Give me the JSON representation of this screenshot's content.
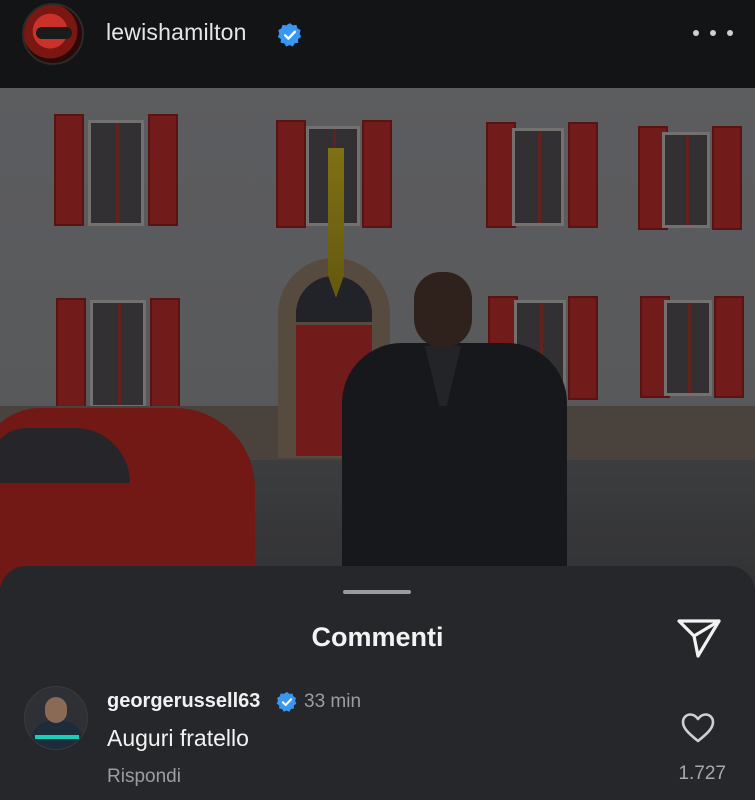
{
  "header": {
    "username": "lewishamilton",
    "verified_icon": "verified-badge-icon",
    "more_icon": "more-options-icon"
  },
  "post": {
    "image_description_icon": "post-photo"
  },
  "comments_sheet": {
    "title": "Commenti",
    "send_icon": "send-icon",
    "comments": [
      {
        "username": "georgerussell63",
        "verified": true,
        "time": "33 min",
        "text": "Auguri fratello",
        "reply_label": "Rispondi",
        "likes": "1.727"
      }
    ]
  },
  "colors": {
    "background": "#111214",
    "sheet": "#25272b",
    "verified_blue": "#3897f0",
    "muted_text": "#9c9da1"
  }
}
